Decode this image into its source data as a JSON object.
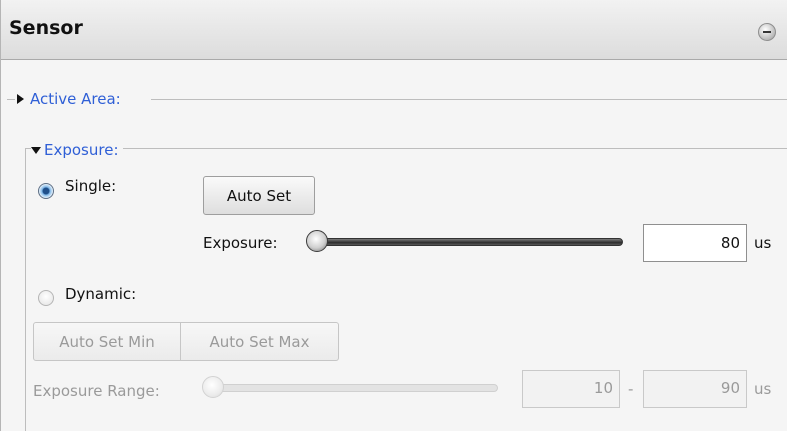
{
  "panel": {
    "title": "Sensor"
  },
  "active_area": {
    "label": "Active Area:"
  },
  "exposure_group": {
    "label": "Exposure:",
    "single": {
      "label": "Single:",
      "selected": true,
      "auto_set_label": "Auto Set",
      "exposure_label": "Exposure:",
      "value": "80",
      "unit": "us"
    },
    "dynamic": {
      "label": "Dynamic:",
      "selected": false,
      "auto_set_min_label": "Auto Set Min",
      "auto_set_max_label": "Auto Set Max",
      "range_label": "Exposure Range:",
      "min_value": "10",
      "separator": "-",
      "max_value": "90",
      "unit": "us"
    }
  },
  "colors": {
    "legend_blue": "#2f5fd6",
    "disabled_text": "#9a9a9a"
  }
}
